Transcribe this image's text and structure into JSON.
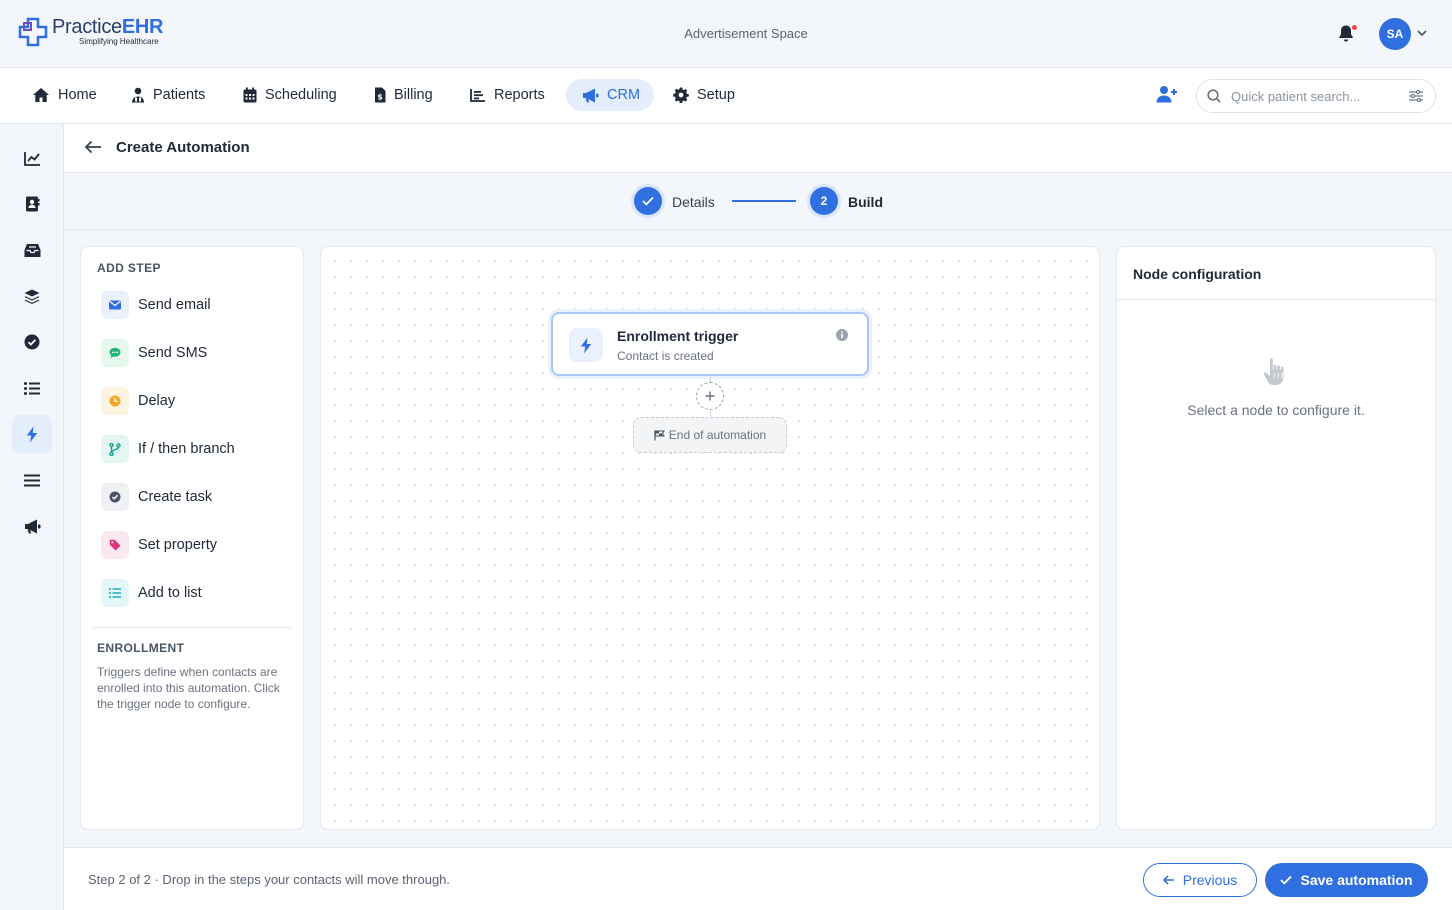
{
  "app": {
    "logo_main": "Practice",
    "logo_accent": "EHR",
    "logo_tagline": "Simplifying Healthcare",
    "ad_space": "Advertisement Space",
    "avatar_initials": "SA"
  },
  "nav": {
    "items": [
      {
        "label": "Home",
        "icon": "home-icon"
      },
      {
        "label": "Patients",
        "icon": "patients-icon"
      },
      {
        "label": "Scheduling",
        "icon": "calendar-icon"
      },
      {
        "label": "Billing",
        "icon": "billing-icon"
      },
      {
        "label": "Reports",
        "icon": "reports-icon"
      },
      {
        "label": "CRM",
        "icon": "megaphone-icon",
        "active": true
      },
      {
        "label": "Setup",
        "icon": "gear-icon"
      }
    ],
    "search_placeholder": "Quick patient search..."
  },
  "sidebar": {
    "icons": [
      "chart-line-icon",
      "contact-book-icon",
      "inbox-icon",
      "layers-icon",
      "check-circle-icon",
      "list-icon",
      "bolt-icon",
      "menu-lines-icon",
      "megaphone-icon"
    ],
    "active_index": 6
  },
  "page": {
    "title": "Create Automation"
  },
  "stepper": {
    "steps": [
      {
        "label": "Details",
        "state": "done"
      },
      {
        "label": "Build",
        "number": "2",
        "state": "current"
      }
    ]
  },
  "add_step": {
    "heading": "ADD STEP",
    "items": [
      {
        "label": "Send email",
        "icon": "mail-icon",
        "color": "#2f6fe0",
        "bg": "#eaf1fd"
      },
      {
        "label": "Send SMS",
        "icon": "sms-icon",
        "color": "#22b573",
        "bg": "#e6f7ee"
      },
      {
        "label": "Delay",
        "icon": "clock-icon",
        "color": "#f5a623",
        "bg": "#fdf3e1"
      },
      {
        "label": "If / then branch",
        "icon": "branch-icon",
        "color": "#14a38b",
        "bg": "#e3f6f2"
      },
      {
        "label": "Create task",
        "icon": "check-circle-icon",
        "color": "#4b5563",
        "bg": "#eef0f3"
      },
      {
        "label": "Set property",
        "icon": "tag-icon",
        "color": "#e0307a",
        "bg": "#fce8f1"
      },
      {
        "label": "Add to list",
        "icon": "list-icon",
        "color": "#16a6b6",
        "bg": "#e3f6f8"
      }
    ],
    "enrollment_heading": "ENROLLMENT",
    "enrollment_text": "Triggers define when contacts are enrolled into this automation. Click the trigger node to configure."
  },
  "canvas": {
    "trigger": {
      "title": "Enrollment trigger",
      "subtitle": "Contact is created",
      "icon": "bolt-icon"
    },
    "end_label": "End of automation"
  },
  "node_config": {
    "title": "Node configuration",
    "empty_text": "Select a node to configure it."
  },
  "footer": {
    "status": "Step 2 of 2 · Drop in the steps your contacts will move through.",
    "previous_label": "Previous",
    "save_label": "Save automation"
  },
  "colors": {
    "accent": "#2f6fe0",
    "accent_light": "#e4edfb"
  }
}
